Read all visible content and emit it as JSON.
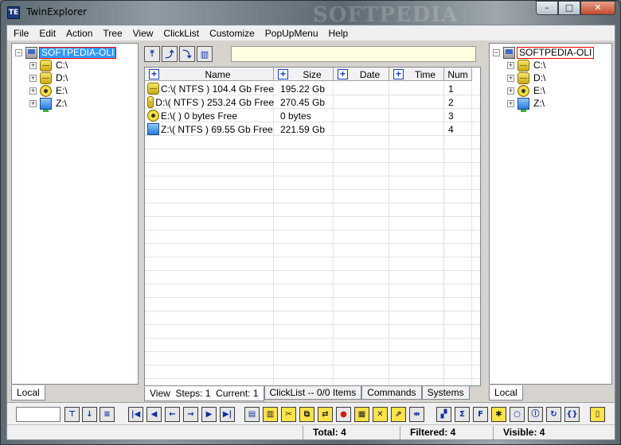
{
  "window": {
    "title": "TwinExplorer",
    "watermark": "SOFTPEDIA",
    "min": "–",
    "max": "□",
    "close": "✕"
  },
  "menu": [
    "File",
    "Edit",
    "Action",
    "Tree",
    "View",
    "ClickList",
    "Customize",
    "PopUpMenu",
    "Help"
  ],
  "left_tree": {
    "root": "SOFTPEDIA-OLI",
    "drives": [
      {
        "label": "C:\\",
        "icon": "hdd-icon"
      },
      {
        "label": "D:\\",
        "icon": "hdd-icon"
      },
      {
        "label": "E:\\",
        "icon": "cd-icon"
      },
      {
        "label": "Z:\\",
        "icon": "network-drive-icon"
      }
    ],
    "tab": "Local"
  },
  "right_tree": {
    "root": "SOFTPEDIA-OLI",
    "drives": [
      {
        "label": "C:\\",
        "icon": "hdd-icon"
      },
      {
        "label": "D:\\",
        "icon": "hdd-icon"
      },
      {
        "label": "E:\\",
        "icon": "cd-icon"
      },
      {
        "label": "Z:\\",
        "icon": "network-drive-icon"
      }
    ],
    "tab": "Local"
  },
  "list": {
    "columns": [
      "Name",
      "Size",
      "Date",
      "Time",
      "Num"
    ],
    "rows": [
      {
        "name": "C:\\( NTFS ) 104.4 Gb Free",
        "size": "195.22 Gb",
        "date": "",
        "time": "",
        "num": "1",
        "icon": "hdd-icon"
      },
      {
        "name": "D:\\( NTFS ) 253.24 Gb Free",
        "size": "270.45 Gb",
        "date": "",
        "time": "",
        "num": "2",
        "icon": "hdd-icon"
      },
      {
        "name": "E:\\(  ) 0 bytes Free",
        "size": "0 bytes",
        "date": "",
        "time": "",
        "num": "3",
        "icon": "cd-icon"
      },
      {
        "name": "Z:\\( NTFS ) 69.55 Gb Free",
        "size": "221.59 Gb",
        "date": "",
        "time": "",
        "num": "4",
        "icon": "network-drive-icon"
      }
    ]
  },
  "bottom_tabs": [
    "View  Steps: 1  Current: 1",
    "ClickList -- 0/0 Items",
    "Commands",
    "Systems"
  ],
  "status": {
    "total": "Total: 4",
    "filtered": "Filtered: 4",
    "visible": "Visible: 4"
  },
  "colors": {
    "selection": "#3399ff",
    "root_border": "#ff0000",
    "path_bg": "#ffffe1"
  }
}
